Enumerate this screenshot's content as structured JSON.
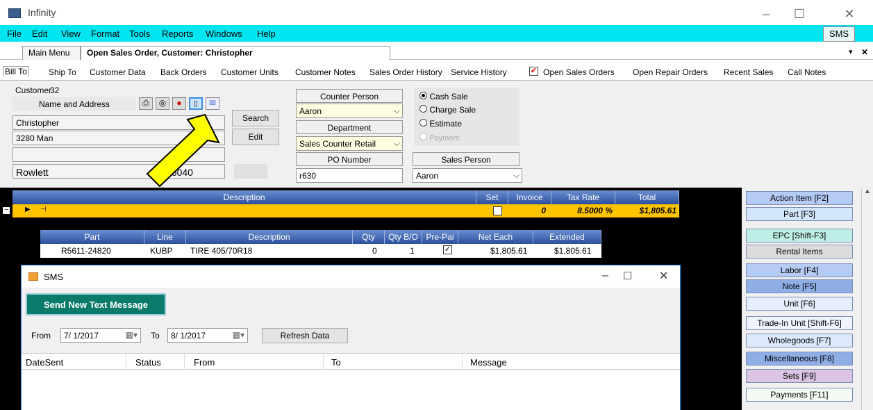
{
  "window": {
    "title": "Infinity",
    "minimize": "–",
    "maximize": "☐",
    "close": "✕"
  },
  "menu": [
    "File",
    "Edit",
    "View",
    "Format",
    "Tools",
    "Reports",
    "Windows",
    "Help"
  ],
  "sms_button": "SMS",
  "doc_tabs": {
    "main": "Main Menu",
    "active": "Open Sales Order, Customer: Christopher",
    "arrow": "▾",
    "close": "✕"
  },
  "sub_tabs": [
    "Bill To",
    "Ship To",
    "Customer Data",
    "Back Orders",
    "Customer Units",
    "Customer Notes",
    "Sales Order History",
    "Service History",
    "Open Sales Orders",
    "Open Repair Orders",
    "Recent Sales",
    "Call Notes"
  ],
  "customer": {
    "label": "Customer",
    "number": "32",
    "name_address_label": "Name and Address",
    "name": "Christopher",
    "address": "3280 Man",
    "address2": "",
    "city": "Rowlett",
    "zip": "76040"
  },
  "actions": {
    "search": "Search",
    "edit": "Edit"
  },
  "counter": {
    "label": "Counter Person",
    "value": "Aaron",
    "dept_label": "Department",
    "dept_value": "Sales Counter Retail",
    "po_label": "PO Number",
    "po_value": "r630"
  },
  "sale_type": {
    "options": [
      "Cash Sale",
      "Charge Sale",
      "Estimate",
      "Payment"
    ],
    "selected": "Cash Sale"
  },
  "sales_person": {
    "label": "Sales Person",
    "value": "Aaron"
  },
  "order_grid": {
    "headers": [
      "Description",
      "Set",
      "Invoice",
      "Tax Rate",
      "Total"
    ],
    "row": {
      "invoice": "0",
      "tax_rate": "8.5000 %",
      "total": "$1,805.61"
    }
  },
  "item_grid": {
    "headers": [
      "Part",
      "Line",
      "Description",
      "Qty",
      "Qty B/O",
      "Pre-Pai",
      "Net Each",
      "Extended"
    ],
    "rows": [
      {
        "part": "R5611-24820",
        "line": "KUBP",
        "description": "TIRE 405/70R18",
        "qty": "0",
        "qty_bo": "1",
        "net_each": "$1,805.61",
        "extended": "$1,805.61"
      }
    ]
  },
  "right_buttons": [
    {
      "label": "Action Item [F2]",
      "color": "#b4ccf4"
    },
    {
      "label": "Part [F3]",
      "color": "#d4e6fb"
    },
    {
      "label": "EPC [Shift-F3]",
      "color": "#bfeee6"
    },
    {
      "label": "Rental Items",
      "color": "#dcdcdc"
    },
    {
      "label": "Labor [F4]",
      "color": "#b4ccf4"
    },
    {
      "label": "Note [F5]",
      "color": "#8faee6"
    },
    {
      "label": "Unit [F6]",
      "color": "#e4eefc"
    },
    {
      "label": "Trade-In Unit [Shift-F6]",
      "color": "#f0f4ff"
    },
    {
      "label": "Wholegoods [F7]",
      "color": "#dce8fb"
    },
    {
      "label": "Miscellaneous [F8]",
      "color": "#8faee6"
    },
    {
      "label": "Sets [F9]",
      "color": "#dcc4e4"
    },
    {
      "label": "Payments [F11]",
      "color": "#f4fbf4"
    }
  ],
  "sms_dialog": {
    "title": "SMS",
    "send_button": "Send New Text Message",
    "from_label": "From",
    "from_date": "7/ 1/2017",
    "to_label": "To",
    "to_date": "8/ 1/2017",
    "refresh": "Refresh Data",
    "columns": [
      "DateSent",
      "Status",
      "From",
      "To",
      "Message"
    ],
    "accent": "#0a7a6a"
  }
}
